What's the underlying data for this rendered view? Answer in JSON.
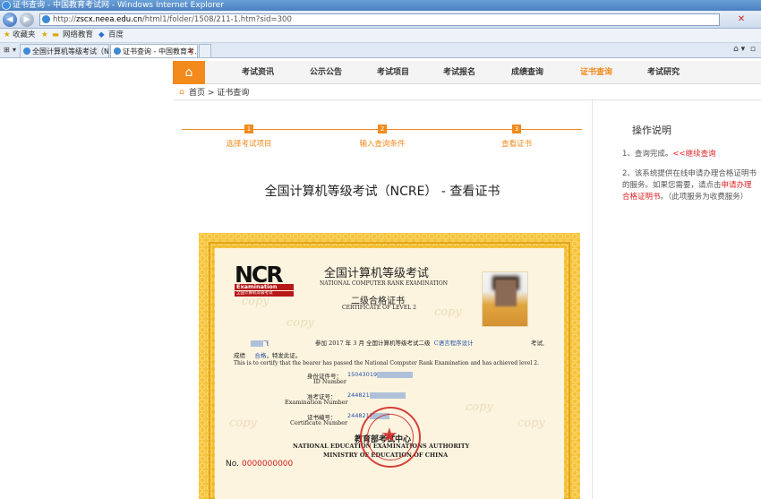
{
  "browser": {
    "title": "证书查询 - 中国教育考试网 - Windows Internet Explorer",
    "url_prefix": "http://",
    "url_host": "zscx.neea.edu.cn",
    "url_path": "/html1/folder/1508/211-1.htm?sid=300",
    "favorites_label": "收藏夹",
    "fav_links": [
      "网络教育",
      "百度"
    ],
    "tabs": [
      "全国计算机等级考试（NC...",
      "证书查询 - 中国教育考..."
    ]
  },
  "site_nav": {
    "items": [
      "考试资讯",
      "公示公告",
      "考试项目",
      "考试报名",
      "成绩查询",
      "证书查询",
      "考试研究"
    ],
    "active_index": 5
  },
  "breadcrumb": {
    "home": "首页",
    "sep": " > ",
    "current": "证书查询"
  },
  "steps": [
    {
      "num": "1",
      "label": "选择考试项目"
    },
    {
      "num": "2",
      "label": "输入查询条件"
    },
    {
      "num": "3",
      "label": "查看证书"
    }
  ],
  "page_title": "全国计算机等级考试（NCRE） - 查看证书",
  "sidebar": {
    "title": "操作说明",
    "item1_prefix": "1、查询完成。",
    "item1_link": "<<继续查询",
    "item2_prefix": "2、该系统提供在线申请办理合格证明书的服务。如果您需要，请点击",
    "item2_link": "申请办理合格证明书",
    "item2_suffix": "。（此项服务为收费服务）"
  },
  "certificate": {
    "logo_text": "NCR",
    "logo_exam": "Examination",
    "logo_sub": "全国计算机等级考试",
    "title_cn": "全国计算机等级考试",
    "title_en": "NATIONAL COMPUTER RANK EXAMINATION",
    "level_cn": "二级合格证书",
    "level_en": "CERTIFICATE OF LEVEL 2",
    "name_tail": "飞",
    "sentence_a": "参加 2017 年 3 月 全国计算机等级考试二级",
    "subject": "C语言程序设计",
    "sentence_b": "考试,",
    "result_prefix": "成绩",
    "result": "合格",
    "result_suffix": "，特发此证。",
    "english_line": "This is to certify that the bearer has passed the National Computer Rank Examination and has achieved level 2.",
    "id_label": "身份证件号：",
    "id_label_en": "ID Number",
    "id_value": "15043019",
    "exam_label": "准考证号：",
    "exam_label_en": "Examination Number",
    "exam_value": "244821",
    "cert_label": "证书编号：",
    "cert_label_en": "Certificate Number",
    "cert_value": "244821",
    "authority_cn": "教育部考试中心",
    "authority_en1": "NATIONAL EDUCATION EXAMINATIONS AUTHORITY",
    "authority_en2": "MINISTRY OF EDUCATION OF CHINA",
    "no_label": "No.",
    "no_value": "0000000000",
    "watermark": "copy"
  }
}
